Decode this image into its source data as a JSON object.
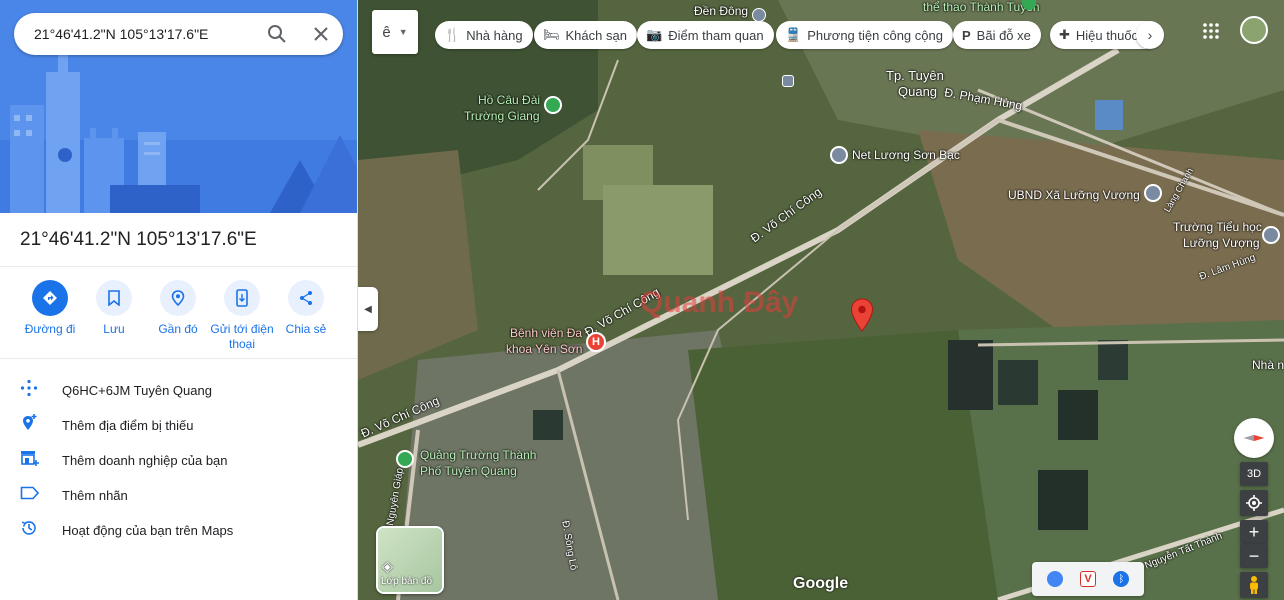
{
  "search": {
    "query": "21°46'41.2\"N 105°13'17.6\"E"
  },
  "place": {
    "title": "21°46'41.2\"N 105°13'17.6\"E",
    "actions": [
      {
        "label": "Đường đi",
        "icon": "directions-icon"
      },
      {
        "label": "Lưu",
        "icon": "bookmark-icon"
      },
      {
        "label": "Gần đó",
        "icon": "nearby-icon"
      },
      {
        "label": "Gửi tới điện thoại",
        "icon": "send-to-phone-icon"
      },
      {
        "label": "Chia sẻ",
        "icon": "share-icon"
      }
    ],
    "info": [
      {
        "text": "Q6HC+6JM Tuyên Quang",
        "icon": "plus-code-icon"
      },
      {
        "text": "Thêm địa điểm bị thiếu",
        "icon": "add-place-icon"
      },
      {
        "text": "Thêm doanh nghiệp của bạn",
        "icon": "add-business-icon"
      },
      {
        "text": "Thêm nhãn",
        "icon": "label-icon"
      },
      {
        "text": "Hoạt động của bạn trên Maps",
        "icon": "history-icon"
      }
    ]
  },
  "map": {
    "language_button": "ê",
    "chips": [
      {
        "label": "Nhà hàng",
        "icon": "restaurant-icon"
      },
      {
        "label": "Khách sạn",
        "icon": "hotel-icon"
      },
      {
        "label": "Điểm tham quan",
        "icon": "camera-icon"
      },
      {
        "label": "Phương tiện công cộng",
        "icon": "transit-icon"
      },
      {
        "label": "Bãi đỗ xe",
        "icon": "parking-icon"
      },
      {
        "label": "Hiệu thuốc",
        "icon": "pharmacy-icon"
      }
    ],
    "labels": {
      "den_dong": "Đền Đông",
      "the_thao": "thể thao Thành Tuyên",
      "tp_tuyen_quang_1": "Tp. Tuyên",
      "tp_tuyen_quang_2": "Quang",
      "pham_hung": "Đ. Phạm Hùng",
      "ho_cau_1": "Hồ Câu Đài",
      "ho_cau_2": "Trường Giang",
      "net_luong_son": "Net Lương Sơn Bạc",
      "ubnd": "UBND Xã Lưỡng Vượng",
      "truong_tieu_hoc_1": "Trường Tiểu học",
      "truong_tieu_hoc_2": "Lưỡng Vượng",
      "vo_chi_cong_1": "Đ. Võ Chí Công",
      "vo_chi_cong_2": "Đ. Võ Chí Công",
      "vo_chi_cong_3": "Đ. Võ Chí Công",
      "benh_vien_1": "Bệnh viện Đa",
      "benh_vien_2": "khoa Yên Sơn",
      "quang_truong_1": "Quảng Trường Thành",
      "quang_truong_2": "Phố Tuyên Quang",
      "vo_nguyen_giap": "Đ. Võ Nguyên Giáp",
      "nha": "Nhà n",
      "nguyen_tat_thanh": "Đ. Nguyễn Tất Thành",
      "song_lo": "Đ. Sông Lô",
      "lang_chanh": "Làng Chanh",
      "lam_hung": "Đ. Lâm Hùng"
    },
    "watermark": "Quanh Đây",
    "google_logo": "Google",
    "layers_label": "Lớp bản đồ",
    "ctrl_3d": "3D"
  }
}
